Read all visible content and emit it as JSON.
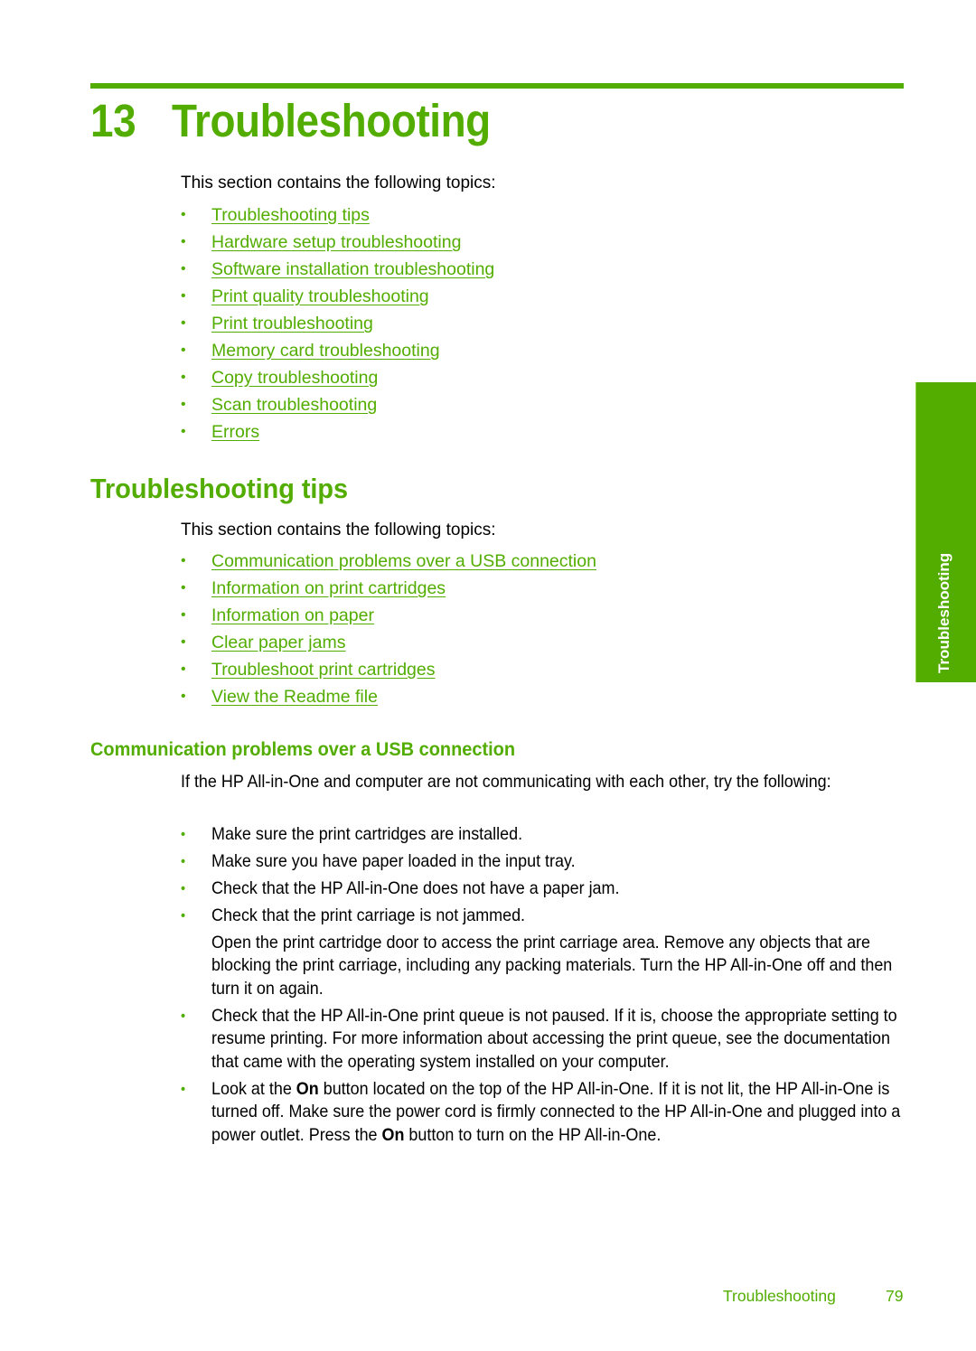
{
  "chapter": {
    "number": "13",
    "title": "Troubleshooting"
  },
  "intro_text": "This section contains the following topics:",
  "chapter_topics": [
    "Troubleshooting tips",
    "Hardware setup troubleshooting",
    "Software installation troubleshooting",
    "Print quality troubleshooting",
    "Print troubleshooting",
    "Memory card troubleshooting",
    "Copy troubleshooting",
    "Scan troubleshooting",
    "Errors"
  ],
  "tips_section": {
    "heading": "Troubleshooting tips",
    "intro_text": "This section contains the following topics:",
    "topics": [
      "Communication problems over a USB connection",
      "Information on print cartridges",
      "Information on paper",
      "Clear paper jams",
      "Troubleshoot print cartridges",
      "View the Readme file"
    ]
  },
  "usb_section": {
    "heading": "Communication problems over a USB connection",
    "intro": "If the HP All-in-One and computer are not communicating with each other, try the following:",
    "steps": [
      {
        "text": "Make sure the print cartridges are installed."
      },
      {
        "text": "Make sure you have paper loaded in the input tray."
      },
      {
        "text": "Check that the HP All-in-One does not have a paper jam."
      },
      {
        "text": "Check that the print carriage is not jammed.",
        "detail": "Open the print cartridge door to access the print carriage area. Remove any objects that are blocking the print carriage, including any packing materials. Turn the HP All-in-One off and then turn it on again."
      },
      {
        "text": "Check that the HP All-in-One print queue is not paused. If it is, choose the appropriate setting to resume printing. For more information about accessing the print queue, see the documentation that came with the operating system installed on your computer."
      },
      {
        "text_parts": [
          "Look at the ",
          "On",
          " button located on the top of the HP All-in-One. If it is not lit, the HP All-in-One is turned off. Make sure the power cord is firmly connected to the HP All-in-One and plugged into a power outlet. Press the ",
          "On",
          " button to turn on the HP All-in-One."
        ]
      }
    ]
  },
  "side_tab": "Troubleshooting",
  "footer": {
    "section": "Troubleshooting",
    "page": "79"
  },
  "colors": {
    "accent": "#52ad00"
  }
}
